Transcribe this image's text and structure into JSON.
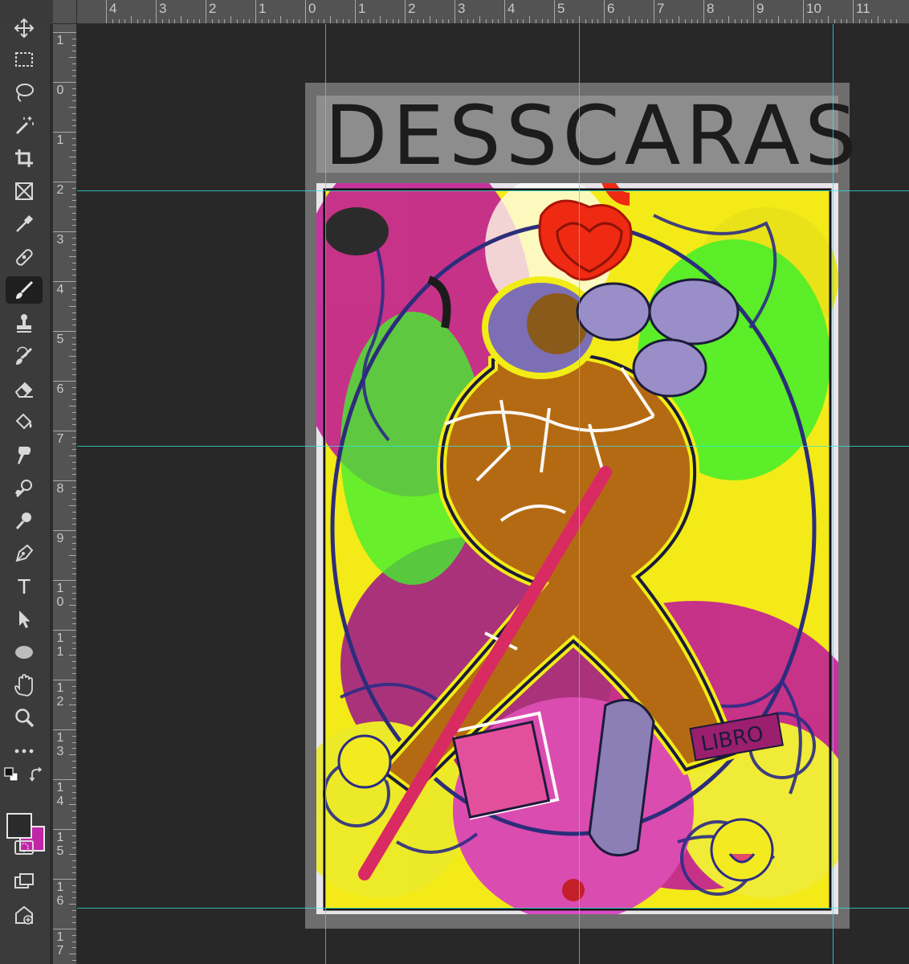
{
  "rulers": {
    "top_labels": [
      "4",
      "3",
      "2",
      "1",
      "0",
      "1",
      "2",
      "3",
      "4",
      "5",
      "6",
      "7",
      "8",
      "9",
      "10",
      "11"
    ],
    "left_labels": [
      "1",
      "0",
      "1",
      "2",
      "3",
      "4",
      "5",
      "6",
      "7",
      "8",
      "9",
      "1 0",
      "1 1",
      "1 2",
      "1 3",
      "1 4",
      "1 5",
      "1 6",
      "1 7"
    ]
  },
  "toolbar": {
    "items": [
      {
        "name": "move-tool",
        "icon": "move-icon",
        "active": false
      },
      {
        "name": "rectangular-marquee-tool",
        "icon": "marquee-icon",
        "active": false
      },
      {
        "name": "lasso-tool",
        "icon": "lasso-icon",
        "active": false
      },
      {
        "name": "magic-wand-tool",
        "icon": "magic-wand-icon",
        "active": false
      },
      {
        "name": "crop-tool",
        "icon": "crop-icon",
        "active": false
      },
      {
        "name": "frame-tool",
        "icon": "frame-icon",
        "active": false
      },
      {
        "name": "eyedropper-tool",
        "icon": "eyedropper-icon",
        "active": false
      },
      {
        "name": "healing-brush-tool",
        "icon": "bandage-icon",
        "active": false
      },
      {
        "name": "brush-tool",
        "icon": "brush-icon",
        "active": true
      },
      {
        "name": "clone-stamp-tool",
        "icon": "stamp-icon",
        "active": false
      },
      {
        "name": "history-brush-tool",
        "icon": "history-brush-icon",
        "active": false
      },
      {
        "name": "eraser-tool",
        "icon": "eraser-icon",
        "active": false
      },
      {
        "name": "paint-bucket-tool",
        "icon": "paint-bucket-icon",
        "active": false
      },
      {
        "name": "smudge-tool",
        "icon": "smudge-icon",
        "active": false
      },
      {
        "name": "dodge-tool",
        "icon": "dodge-icon",
        "active": false
      },
      {
        "name": "burn-tool",
        "icon": "burn-icon",
        "active": false
      },
      {
        "name": "pen-tool",
        "icon": "pen-icon",
        "active": false
      },
      {
        "name": "type-tool",
        "icon": "type-icon",
        "active": false
      },
      {
        "name": "path-selection-tool",
        "icon": "arrow-icon",
        "active": false
      },
      {
        "name": "ellipse-tool",
        "icon": "ellipse-icon",
        "active": false
      },
      {
        "name": "hand-tool",
        "icon": "hand-icon",
        "active": false
      },
      {
        "name": "zoom-tool",
        "icon": "zoom-icon",
        "active": false
      },
      {
        "name": "more-tools",
        "icon": "ellipsis-icon",
        "active": false
      }
    ],
    "type_glyph": "T",
    "foreground_color": "#2b2b2b",
    "background_color": "#c026a6",
    "bottom_items": [
      {
        "name": "quick-mask-button",
        "icon": "quick-mask-icon"
      },
      {
        "name": "screen-mode-button",
        "icon": "screen-mode-icon"
      },
      {
        "name": "artboard-add-button",
        "icon": "artboard-icon"
      }
    ]
  },
  "canvas": {
    "title_text": "DESSCARAS",
    "sign_text": "LIBRO",
    "guide_color": "#2ee6e6",
    "artboard_color": "#6e6e6e",
    "title_band_color": "#8d8d8d"
  }
}
